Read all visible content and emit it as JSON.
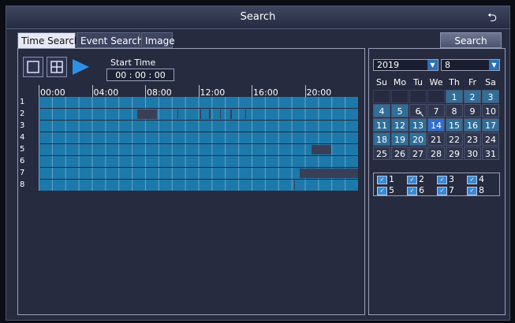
{
  "window": {
    "title": "Search",
    "back_icon": "back-arrow-icon"
  },
  "tabs": [
    {
      "label": "Time Search",
      "active": true
    },
    {
      "label": "Event Search",
      "active": false
    },
    {
      "label": "Image",
      "active": false
    }
  ],
  "search_button": "Search",
  "toolbar": {
    "view_single": "single-view-icon",
    "view_quad": "quad-view-icon",
    "play": "play-icon"
  },
  "start_time": {
    "label": "Start Time",
    "value": "00 : 00 : 00"
  },
  "timeline": {
    "hours": [
      "00:00",
      "04:00",
      "08:00",
      "12:00",
      "16:00",
      "20:00"
    ],
    "channels": [
      {
        "num": "1",
        "segments": []
      },
      {
        "num": "2",
        "segments": [
          [
            7.4,
            8.9
          ],
          [
            10.4,
            10.5
          ],
          [
            12.1,
            12.2
          ],
          [
            12.8,
            12.9
          ],
          [
            13.6,
            13.7
          ],
          [
            14.4,
            14.5
          ],
          [
            15.5,
            15.6
          ]
        ]
      },
      {
        "num": "3",
        "segments": []
      },
      {
        "num": "4",
        "segments": []
      },
      {
        "num": "5",
        "segments": [
          [
            20.5,
            22.0
          ]
        ]
      },
      {
        "num": "6",
        "segments": []
      },
      {
        "num": "7",
        "segments": [
          [
            19.6,
            24.0
          ]
        ]
      },
      {
        "num": "8",
        "segments": [
          [
            19.2,
            19.25
          ]
        ]
      }
    ],
    "colors": {
      "grid": "#1d79aa",
      "record": "#3a3f58"
    }
  },
  "calendar": {
    "year": "2019",
    "month": "8",
    "weekdays": [
      "Su",
      "Mo",
      "Tu",
      "We",
      "Th",
      "Fr",
      "Sa"
    ],
    "first_weekday_index": 4,
    "days": 31,
    "recorded_days": [
      1,
      2,
      3,
      4,
      5,
      11,
      12,
      13,
      15,
      16,
      17,
      18,
      19,
      20
    ],
    "selected_day": 14,
    "cursor_day": 6
  },
  "channels": [
    {
      "label": "1",
      "checked": true
    },
    {
      "label": "2",
      "checked": true
    },
    {
      "label": "3",
      "checked": true
    },
    {
      "label": "4",
      "checked": true
    },
    {
      "label": "5",
      "checked": true
    },
    {
      "label": "6",
      "checked": true
    },
    {
      "label": "7",
      "checked": true
    },
    {
      "label": "8",
      "checked": true
    }
  ]
}
